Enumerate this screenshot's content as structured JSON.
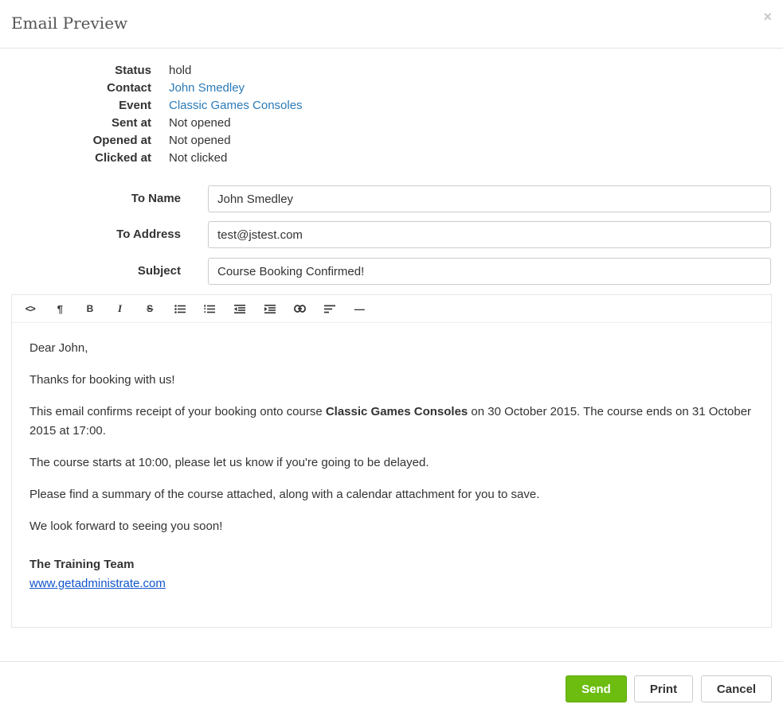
{
  "header": {
    "title": "Email Preview",
    "close_glyph": "×"
  },
  "meta": [
    {
      "label": "Status",
      "value": "hold"
    },
    {
      "label": "Contact",
      "value": "John Smedley"
    },
    {
      "label": "Event",
      "value": "Classic Games Consoles"
    },
    {
      "label": "Sent at",
      "value": "Not opened"
    },
    {
      "label": "Opened at",
      "value": "Not opened"
    },
    {
      "label": "Clicked at",
      "value": "Not clicked"
    }
  ],
  "form": {
    "to_name": {
      "label": "To Name",
      "value": "John Smedley"
    },
    "to_address": {
      "label": "To Address",
      "value": "test@jstest.com"
    },
    "subject": {
      "label": "Subject",
      "value": "Course Booking Confirmed!"
    }
  },
  "toolbar": {
    "icons": [
      "code-icon",
      "paragraph-icon",
      "bold-icon",
      "italic-icon",
      "strikethrough-icon",
      "bulleted-list-icon",
      "numbered-list-icon",
      "outdent-icon",
      "indent-icon",
      "link-icon",
      "align-icon",
      "horizontal-rule-icon"
    ],
    "code_glyph": "<>",
    "paragraph_glyph": "¶",
    "bold_glyph": "B",
    "italic_glyph": "I",
    "strike_glyph": "S",
    "hr_glyph": "—"
  },
  "email": {
    "greeting": "Dear John,",
    "thanks": "Thanks for booking with us!",
    "confirm_prefix": "This email confirms receipt of your booking onto course ",
    "confirm_course": "Classic Games Consoles",
    "confirm_suffix": " on 30 October 2015. The course ends on 31 October 2015 at 17:00.",
    "start": "The course starts at 10:00, please let us know if you're going to be delayed.",
    "summary": "Please find a summary of the course attached, along with a calendar attachment for you to save.",
    "closing": "We look forward to seeing you soon!",
    "signature_name": "The Training Team",
    "signature_link": "www.getadministrate.com"
  },
  "footer": {
    "send": "Send",
    "print": "Print",
    "cancel": "Cancel"
  },
  "colors": {
    "accent_send": "#6cbd10",
    "link": "#2a7ab8",
    "body_link": "#1155cc"
  }
}
